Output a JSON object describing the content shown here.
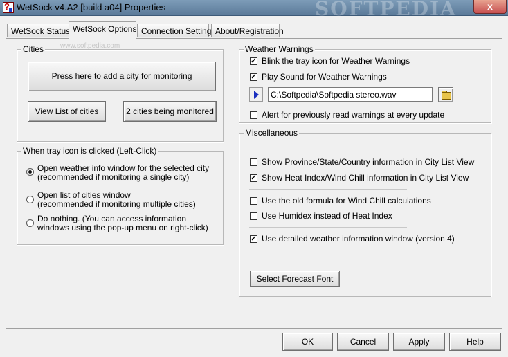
{
  "window": {
    "title": "WetSock v4.A2 [build a04] Properties",
    "watermark": "SOFTPEDIA",
    "close_label": "x"
  },
  "tabs": [
    {
      "label": "WetSock Status"
    },
    {
      "label": "WetSock Options"
    },
    {
      "label": "Connection Settings"
    },
    {
      "label": "About/Registration"
    }
  ],
  "active_tab": "WetSock Options",
  "cities": {
    "group_label": "Cities",
    "add_city_button": "Press here to add a city for monitoring",
    "view_list_button": "View List of cities",
    "monitored_button": "2 cities being monitored",
    "watermark_url": "www.softpedia.com"
  },
  "tray_click": {
    "group_label": "When tray icon is clicked (Left-Click)",
    "options": [
      {
        "line1": "Open weather info window for the selected city",
        "line2": "(recommended if monitoring a single city)",
        "selected": true
      },
      {
        "line1": "Open list of cities window",
        "line2": "(recommended if monitoring multiple cities)",
        "selected": false
      },
      {
        "line1": "Do nothing. (You can access information",
        "line2": "windows using the pop-up menu on right-click)",
        "selected": false
      }
    ]
  },
  "weather_warnings": {
    "group_label": "Weather Warnings",
    "blink_tray": {
      "label": "Blink the tray icon for Weather Warnings",
      "checked": true
    },
    "play_sound": {
      "label": "Play Sound for Weather Warnings",
      "checked": true
    },
    "sound_path": "C:\\Softpedia\\Softpedia stereo.wav",
    "alert_previous": {
      "label": "Alert for previously read warnings at every update",
      "checked": false
    }
  },
  "misc": {
    "group_label": "Miscellaneous",
    "options": [
      {
        "label": "Show Province/State/Country information in City List View",
        "checked": false
      },
      {
        "label": "Show Heat Index/Wind Chill information in City List View",
        "checked": true
      },
      {
        "label": "Use the old formula for Wind Chill calculations",
        "checked": false
      },
      {
        "label": "Use Humidex instead of Heat Index",
        "checked": false
      },
      {
        "label": "Use detailed weather information window (version 4)",
        "checked": true
      }
    ],
    "forecast_font_button": "Select Forecast Font"
  },
  "footer": {
    "ok": "OK",
    "cancel": "Cancel",
    "apply": "Apply",
    "help": "Help"
  }
}
